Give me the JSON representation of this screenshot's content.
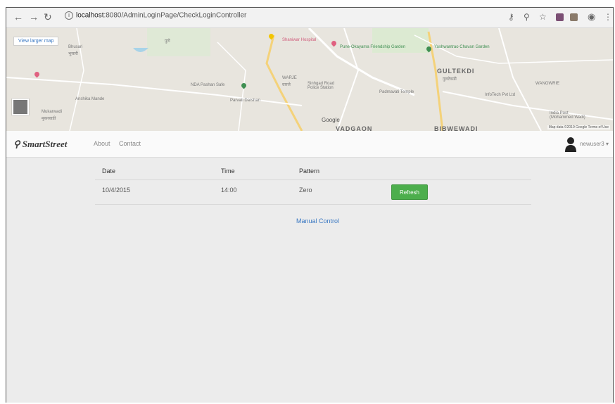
{
  "browser": {
    "host": "localhost",
    "url_rest": ":8080/AdminLoginPage/CheckLoginController",
    "info_glyph": "i",
    "icons": [
      "back-icon",
      "forward-icon",
      "reload-icon",
      "key-icon",
      "zoom-icon",
      "star-icon",
      "extension-icon",
      "extension-icon",
      "profile-icon"
    ]
  },
  "map": {
    "view_larger": "View larger map",
    "labels": {
      "bhusari": "Bhusari",
      "bhusari_mr": "भुसारी",
      "pune_lbl": "पुणे",
      "shaniwar": "Shaniwar Hospital",
      "pune_okayama": "Pune-Okayama Friendship Garden",
      "yashwantrao": "Yashwantrao Chavan Garden",
      "gultekdi": "GULTEKDI",
      "gultekdi_mr": "गुलटेकडी",
      "wanowrie": "WANOWRIE",
      "nda_pashan": "NDA Pashan Safe",
      "anshika": "Anshika Mande",
      "mukarwadi": "Mukarwadi",
      "mukarwadi_mr": "मुकरवाडी",
      "parvati": "Parvati Darshan",
      "warje": "WARJE",
      "warje_mr": "वारजे",
      "sinhgad_police": "Sinhgad Road Police Station",
      "padmavati": "Padmavati Temple",
      "infotech": "InfoTech Pvt Ltd",
      "bibwewadi": "BIBWEWADI",
      "vadgaon": "VADGAON",
      "google": "Google",
      "india_post": "India Post (Mohammed Wadi)",
      "attribution": "Map data ©2019 Google  Terms of Use"
    }
  },
  "navbar": {
    "brand": "SmartStreet",
    "links": [
      "About",
      "Contact"
    ],
    "user": "newuser3 ▾"
  },
  "table": {
    "headers": [
      "Date",
      "Time",
      "Pattern"
    ],
    "rows": [
      {
        "date": "10/4/2015",
        "time": "14:00",
        "pattern": "Zero"
      }
    ],
    "refresh_label": "Refresh"
  },
  "manual_control": "Manual Control",
  "colors": {
    "refresh_green": "#4cae4c",
    "link_blue": "#3a78c2",
    "page_bg": "#ececec"
  }
}
